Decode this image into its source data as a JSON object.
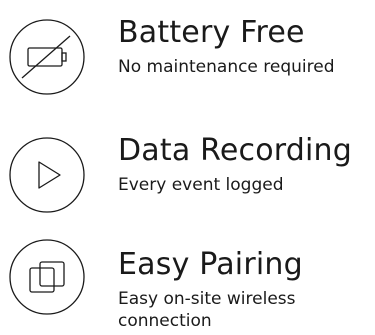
{
  "features": [
    {
      "icon": "battery-crossed-icon",
      "title": "Battery Free",
      "description": "No maintenance required"
    },
    {
      "icon": "play-icon",
      "title": "Data Recording",
      "description": "Every event logged"
    },
    {
      "icon": "pairing-squares-icon",
      "title": "Easy Pairing",
      "description": "Easy on-site wireless connection"
    }
  ],
  "colors": {
    "text": "#1a1a1a",
    "icon_stroke": "#1a1a1a",
    "background": "#ffffff"
  }
}
